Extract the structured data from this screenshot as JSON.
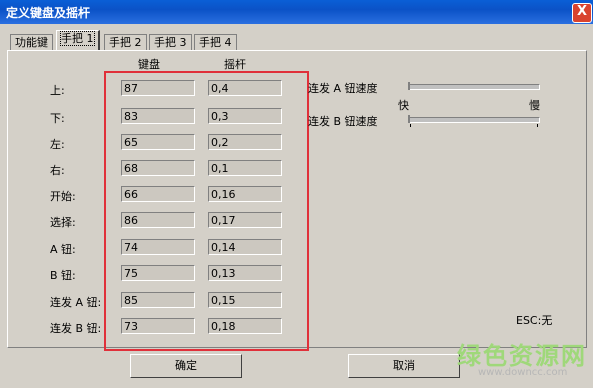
{
  "window": {
    "title": "定义键盘及摇杆",
    "close": "X"
  },
  "tabs": [
    {
      "label": "功能键"
    },
    {
      "label": "手把 1"
    },
    {
      "label": "手把 2"
    },
    {
      "label": "手把 3"
    },
    {
      "label": "手把 4"
    }
  ],
  "columns": {
    "keyboard": "键盘",
    "joystick": "摇杆"
  },
  "rows": [
    {
      "label": "上:",
      "keyboard": "87",
      "joystick": "0,4"
    },
    {
      "label": "下:",
      "keyboard": "83",
      "joystick": "0,3"
    },
    {
      "label": "左:",
      "keyboard": "65",
      "joystick": "0,2"
    },
    {
      "label": "右:",
      "keyboard": "68",
      "joystick": "0,1"
    },
    {
      "label": "开始:",
      "keyboard": "66",
      "joystick": "0,16"
    },
    {
      "label": "选择:",
      "keyboard": "86",
      "joystick": "0,17"
    },
    {
      "label": "A 钮:",
      "keyboard": "74",
      "joystick": "0,14"
    },
    {
      "label": "B 钮:",
      "keyboard": "75",
      "joystick": "0,13"
    },
    {
      "label": "连发 A 钮:",
      "keyboard": "85",
      "joystick": "0,15"
    },
    {
      "label": "连发 B 钮:",
      "keyboard": "73",
      "joystick": "0,18"
    }
  ],
  "speed": {
    "a_label": "连发 A 钮速度",
    "b_label": "连发 B 钮速度",
    "fast": "快",
    "slow": "慢"
  },
  "esc_note": "ESC:无",
  "buttons": {
    "ok": "确定",
    "cancel": "取消"
  },
  "watermark": {
    "text": "绿色资源网",
    "url": "www.downcc.com"
  }
}
